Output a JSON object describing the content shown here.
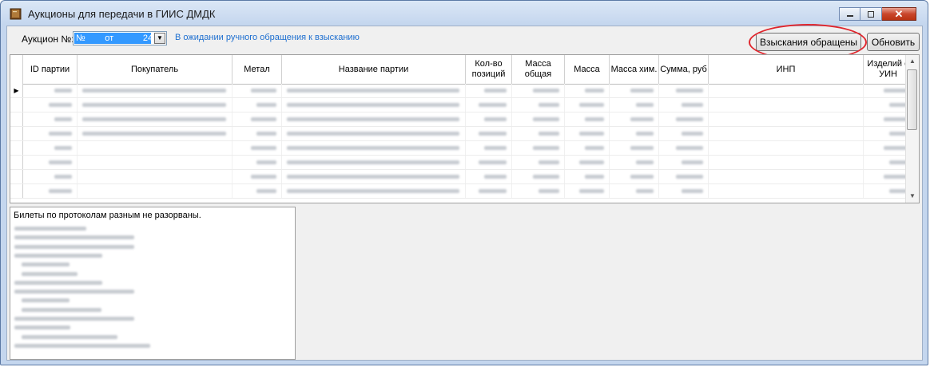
{
  "window": {
    "title": "Аукционы для передачи в ГИИС ДМДК"
  },
  "toolbar": {
    "auction_label": "Аукцион №:",
    "auction_value": "№        от            24",
    "status_text": "В ожидании ручного обращения к взысканию",
    "vz_button": "Взыскания обращены",
    "refresh_button": "Обновить"
  },
  "grid": {
    "columns": [
      "ID партии",
      "Покупатель",
      "Метал",
      "Название партии",
      "Кол-во позиций",
      "Масса общая",
      "Масса",
      "Масса хим.",
      "Сумма, руб",
      "ИНП",
      "Изделий с УИН"
    ]
  },
  "memo": {
    "first_line": "Билеты по протоколам разным не разорваны."
  },
  "colors": {
    "accent": "#1e6fd0",
    "highlight": "#e0262d",
    "selection": "#3399ff"
  }
}
